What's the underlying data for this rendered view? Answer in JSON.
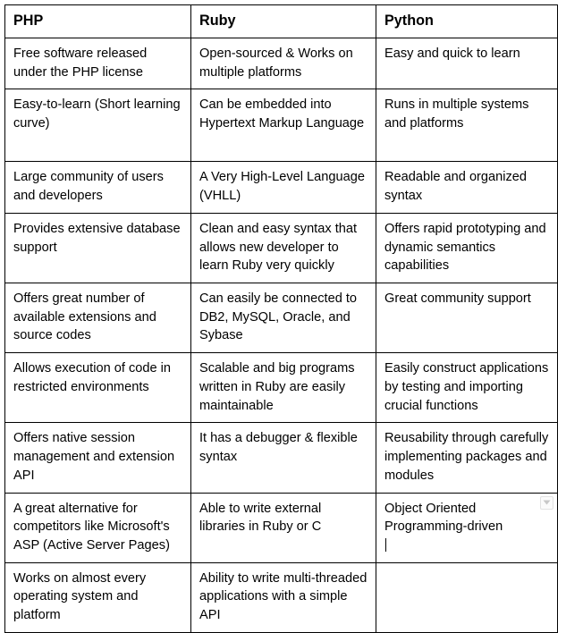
{
  "table": {
    "headers": [
      "PHP",
      "Ruby",
      "Python"
    ],
    "rows": [
      {
        "php": "Free software released under the PHP license",
        "ruby": "Open-sourced & Works on multiple platforms",
        "python": "Easy and quick to learn"
      },
      {
        "php": "Easy-to-learn (Short learning curve)",
        "ruby": "Can be embedded into Hypertext Markup Language",
        "python": "Runs in multiple systems and platforms"
      },
      {
        "php": "Large community of users and developers",
        "ruby": "A Very High-Level Language (VHLL)",
        "python": "Readable and organized syntax"
      },
      {
        "php": "Provides extensive database support",
        "ruby": "Clean and easy syntax that allows new developer to learn Ruby very quickly",
        "python": "Offers rapid prototyping and dynamic semantics capabilities"
      },
      {
        "php": "Offers great number of available extensions and source codes",
        "ruby": "Can easily be connected to DB2, MySQL, Oracle, and Sybase",
        "python": "Great community support"
      },
      {
        "php": "Allows execution of code in restricted environments",
        "ruby": "Scalable and big programs written in Ruby are easily maintainable",
        "python": "Easily construct applications by testing and importing crucial functions"
      },
      {
        "php": "Offers native session management and extension API",
        "ruby": "It has a debugger & flexible syntax",
        "python": "Reusability through carefully implementing packages and modules"
      },
      {
        "php": "A great alternative for competitors like Microsoft's ASP (Active Server Pages)",
        "ruby": "Able to write external libraries in Ruby or C",
        "python": "Object Oriented Programming-driven"
      },
      {
        "php": "Works on almost every operating system and platform",
        "ruby": "Ability to write multi-threaded applications with a simple API",
        "python": ""
      }
    ]
  },
  "overlay": {
    "dropdown_icon": "chevron-down-icon",
    "caret_present": true
  },
  "colors": {
    "border": "#000000",
    "text": "#000000",
    "background": "#ffffff",
    "affordance_border": "#e2e2e2"
  }
}
